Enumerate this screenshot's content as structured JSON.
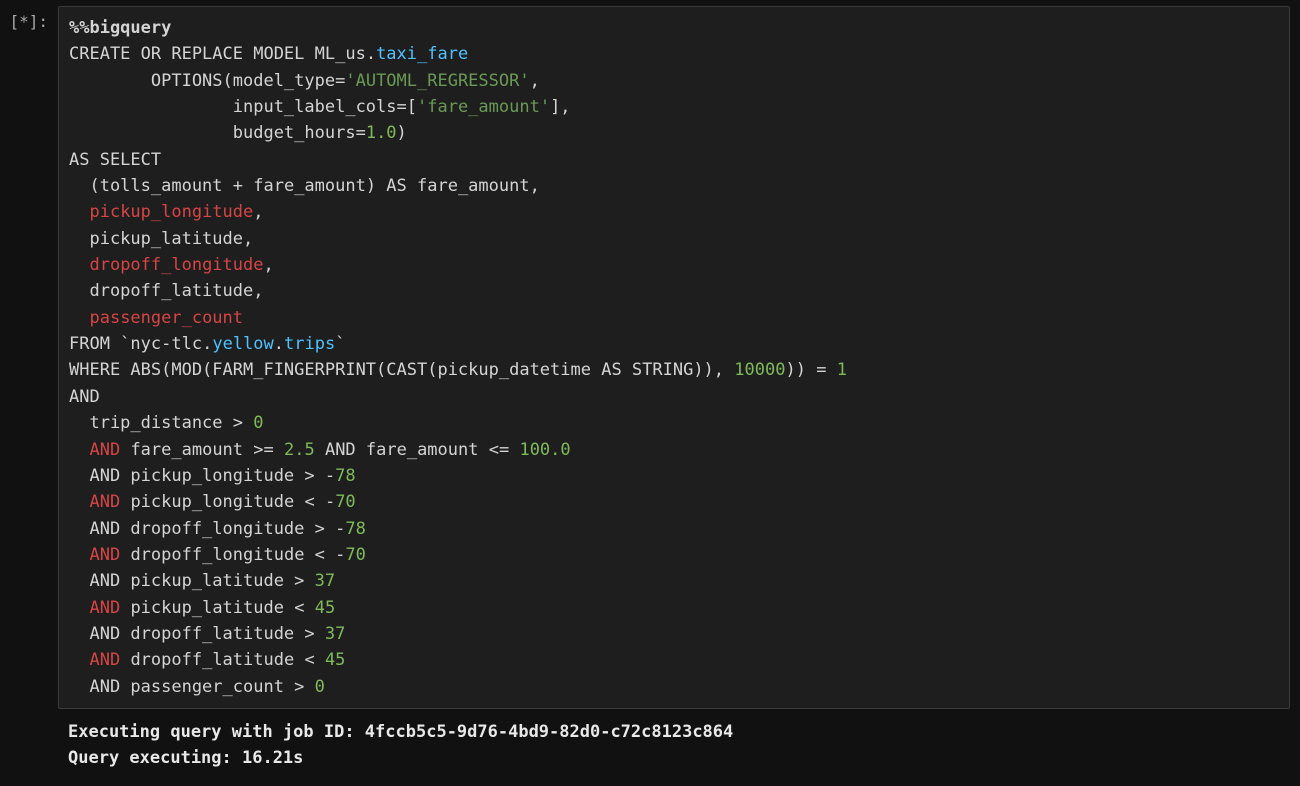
{
  "cell": {
    "prompt": "[*]:",
    "code": {
      "lines": [
        [
          {
            "c": "tok-magic",
            "t": "%%bigquery"
          }
        ],
        [
          {
            "c": "tok-default",
            "t": "CREATE OR REPLACE MODEL ML_us"
          },
          {
            "c": "tok-default",
            "t": "."
          },
          {
            "c": "tok-blue",
            "t": "taxi_fare"
          }
        ],
        [
          {
            "c": "tok-default",
            "t": "        OPTIONS(model_type"
          },
          {
            "c": "tok-default",
            "t": "="
          },
          {
            "c": "tok-green",
            "t": "'AUTOML_REGRESSOR'"
          },
          {
            "c": "tok-default",
            "t": ","
          }
        ],
        [
          {
            "c": "tok-default",
            "t": "                input_label_cols"
          },
          {
            "c": "tok-default",
            "t": "=["
          },
          {
            "c": "tok-green",
            "t": "'fare_amount'"
          },
          {
            "c": "tok-default",
            "t": "],"
          }
        ],
        [
          {
            "c": "tok-default",
            "t": "                budget_hours"
          },
          {
            "c": "tok-default",
            "t": "="
          },
          {
            "c": "tok-num",
            "t": "1.0"
          },
          {
            "c": "tok-default",
            "t": ")"
          }
        ],
        [
          {
            "c": "tok-default",
            "t": "AS SELECT"
          }
        ],
        [
          {
            "c": "tok-default",
            "t": "  (tolls_amount "
          },
          {
            "c": "tok-default",
            "t": "+"
          },
          {
            "c": "tok-default",
            "t": " fare_amount) AS fare_amount,"
          }
        ],
        [
          {
            "c": "tok-default",
            "t": "  "
          },
          {
            "c": "tok-red",
            "t": "pickup_longitude"
          },
          {
            "c": "tok-default",
            "t": ","
          }
        ],
        [
          {
            "c": "tok-default",
            "t": "  pickup_latitude,"
          }
        ],
        [
          {
            "c": "tok-default",
            "t": "  "
          },
          {
            "c": "tok-red",
            "t": "dropoff_longitude"
          },
          {
            "c": "tok-default",
            "t": ","
          }
        ],
        [
          {
            "c": "tok-default",
            "t": "  dropoff_latitude,"
          }
        ],
        [
          {
            "c": "tok-default",
            "t": "  "
          },
          {
            "c": "tok-red",
            "t": "passenger_count"
          }
        ],
        [
          {
            "c": "tok-default",
            "t": "FROM `nyc"
          },
          {
            "c": "tok-default",
            "t": "-"
          },
          {
            "c": "tok-default",
            "t": "tlc"
          },
          {
            "c": "tok-default",
            "t": "."
          },
          {
            "c": "tok-blue",
            "t": "yellow"
          },
          {
            "c": "tok-default",
            "t": "."
          },
          {
            "c": "tok-blue",
            "t": "trips"
          },
          {
            "c": "tok-default",
            "t": "`"
          }
        ],
        [
          {
            "c": "tok-default",
            "t": "WHERE ABS(MOD(FARM_FINGERPRINT(CAST(pickup_datetime AS STRING)), "
          },
          {
            "c": "tok-num",
            "t": "10000"
          },
          {
            "c": "tok-default",
            "t": ")) "
          },
          {
            "c": "tok-default",
            "t": "="
          },
          {
            "c": "tok-default",
            "t": " "
          },
          {
            "c": "tok-num",
            "t": "1"
          }
        ],
        [
          {
            "c": "tok-default",
            "t": "AND"
          }
        ],
        [
          {
            "c": "tok-default",
            "t": "  trip_distance "
          },
          {
            "c": "tok-default",
            "t": ">"
          },
          {
            "c": "tok-default",
            "t": " "
          },
          {
            "c": "tok-num",
            "t": "0"
          }
        ],
        [
          {
            "c": "tok-default",
            "t": "  "
          },
          {
            "c": "tok-red",
            "t": "AND"
          },
          {
            "c": "tok-default",
            "t": " fare_amount "
          },
          {
            "c": "tok-default",
            "t": ">="
          },
          {
            "c": "tok-default",
            "t": " "
          },
          {
            "c": "tok-num",
            "t": "2.5"
          },
          {
            "c": "tok-default",
            "t": " AND fare_amount "
          },
          {
            "c": "tok-default",
            "t": "<="
          },
          {
            "c": "tok-default",
            "t": " "
          },
          {
            "c": "tok-num",
            "t": "100.0"
          }
        ],
        [
          {
            "c": "tok-default",
            "t": "  AND pickup_longitude "
          },
          {
            "c": "tok-default",
            "t": ">"
          },
          {
            "c": "tok-default",
            "t": " "
          },
          {
            "c": "tok-default",
            "t": "-"
          },
          {
            "c": "tok-num",
            "t": "78"
          }
        ],
        [
          {
            "c": "tok-default",
            "t": "  "
          },
          {
            "c": "tok-red",
            "t": "AND"
          },
          {
            "c": "tok-default",
            "t": " pickup_longitude "
          },
          {
            "c": "tok-default",
            "t": "<"
          },
          {
            "c": "tok-default",
            "t": " "
          },
          {
            "c": "tok-default",
            "t": "-"
          },
          {
            "c": "tok-num",
            "t": "70"
          }
        ],
        [
          {
            "c": "tok-default",
            "t": "  AND dropoff_longitude "
          },
          {
            "c": "tok-default",
            "t": ">"
          },
          {
            "c": "tok-default",
            "t": " "
          },
          {
            "c": "tok-default",
            "t": "-"
          },
          {
            "c": "tok-num",
            "t": "78"
          }
        ],
        [
          {
            "c": "tok-default",
            "t": "  "
          },
          {
            "c": "tok-red",
            "t": "AND"
          },
          {
            "c": "tok-default",
            "t": " dropoff_longitude "
          },
          {
            "c": "tok-default",
            "t": "<"
          },
          {
            "c": "tok-default",
            "t": " "
          },
          {
            "c": "tok-default",
            "t": "-"
          },
          {
            "c": "tok-num",
            "t": "70"
          }
        ],
        [
          {
            "c": "tok-default",
            "t": "  AND pickup_latitude "
          },
          {
            "c": "tok-default",
            "t": ">"
          },
          {
            "c": "tok-default",
            "t": " "
          },
          {
            "c": "tok-num",
            "t": "37"
          }
        ],
        [
          {
            "c": "tok-default",
            "t": "  "
          },
          {
            "c": "tok-red",
            "t": "AND"
          },
          {
            "c": "tok-default",
            "t": " pickup_latitude "
          },
          {
            "c": "tok-default",
            "t": "<"
          },
          {
            "c": "tok-default",
            "t": " "
          },
          {
            "c": "tok-num",
            "t": "45"
          }
        ],
        [
          {
            "c": "tok-default",
            "t": "  AND dropoff_latitude "
          },
          {
            "c": "tok-default",
            "t": ">"
          },
          {
            "c": "tok-default",
            "t": " "
          },
          {
            "c": "tok-num",
            "t": "37"
          }
        ],
        [
          {
            "c": "tok-default",
            "t": "  "
          },
          {
            "c": "tok-red",
            "t": "AND"
          },
          {
            "c": "tok-default",
            "t": " dropoff_latitude "
          },
          {
            "c": "tok-default",
            "t": "<"
          },
          {
            "c": "tok-default",
            "t": " "
          },
          {
            "c": "tok-num",
            "t": "45"
          }
        ],
        [
          {
            "c": "tok-default",
            "t": "  AND passenger_count "
          },
          {
            "c": "tok-default",
            "t": ">"
          },
          {
            "c": "tok-default",
            "t": " "
          },
          {
            "c": "tok-num",
            "t": "0"
          }
        ]
      ]
    }
  },
  "output": {
    "line1": "Executing query with job ID: 4fccb5c5-9d76-4bd9-82d0-c72c8123c864",
    "line2": "Query executing: 16.21s"
  }
}
